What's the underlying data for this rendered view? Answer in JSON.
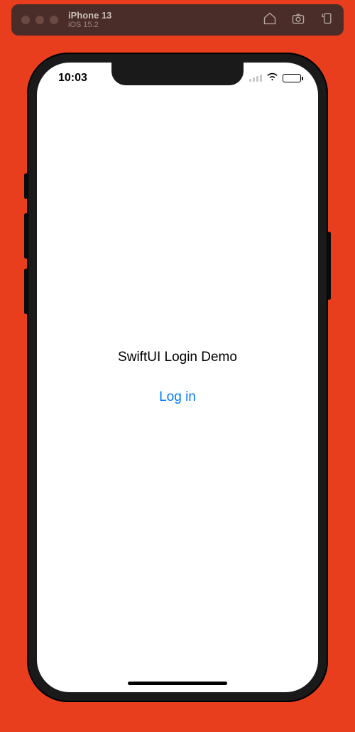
{
  "simulator": {
    "device_name": "iPhone 13",
    "os_version": "iOS 15.2",
    "actions": {
      "home": "home-icon",
      "screenshot": "screenshot-icon",
      "rotate": "rotate-icon"
    }
  },
  "status_bar": {
    "time": "10:03"
  },
  "app": {
    "title": "SwiftUI Login Demo",
    "login_label": "Log in"
  },
  "colors": {
    "background": "#e83e1e",
    "link": "#007aff"
  }
}
